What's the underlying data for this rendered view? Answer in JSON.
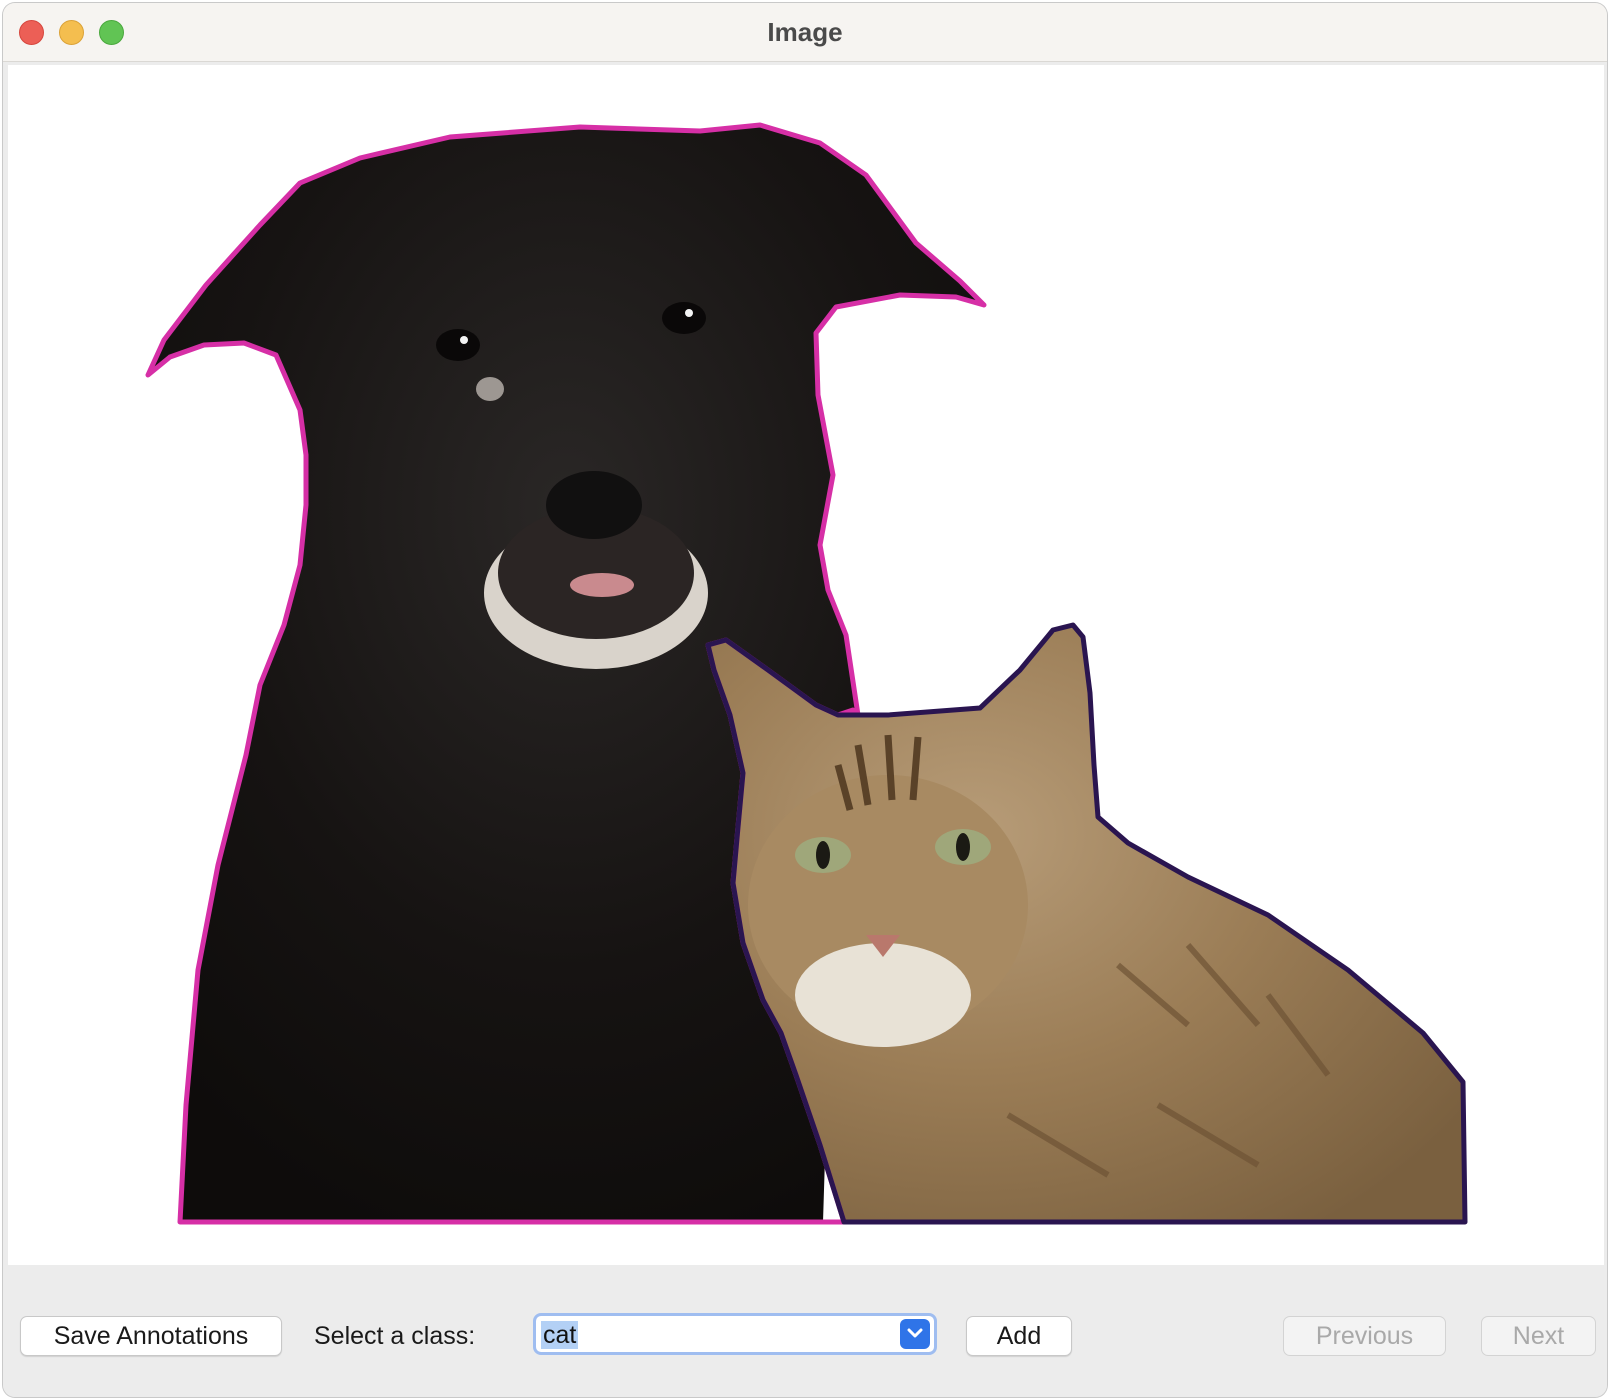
{
  "window": {
    "title": "Image"
  },
  "canvas": {
    "annotations": [
      {
        "class": "dog",
        "outline_color": "#d62fa6",
        "icon": "dog-photo"
      },
      {
        "class": "cat",
        "outline_color": "#2a1550",
        "icon": "cat-photo"
      }
    ]
  },
  "toolbar": {
    "save_label": "Save Annotations",
    "select_label": "Select a class:",
    "class_value": "cat",
    "add_label": "Add",
    "previous_label": "Previous",
    "next_label": "Next"
  },
  "colors": {
    "accent": "#2f74e8",
    "focus_ring": "#9fbdf0",
    "selection": "#b3d0f5"
  }
}
